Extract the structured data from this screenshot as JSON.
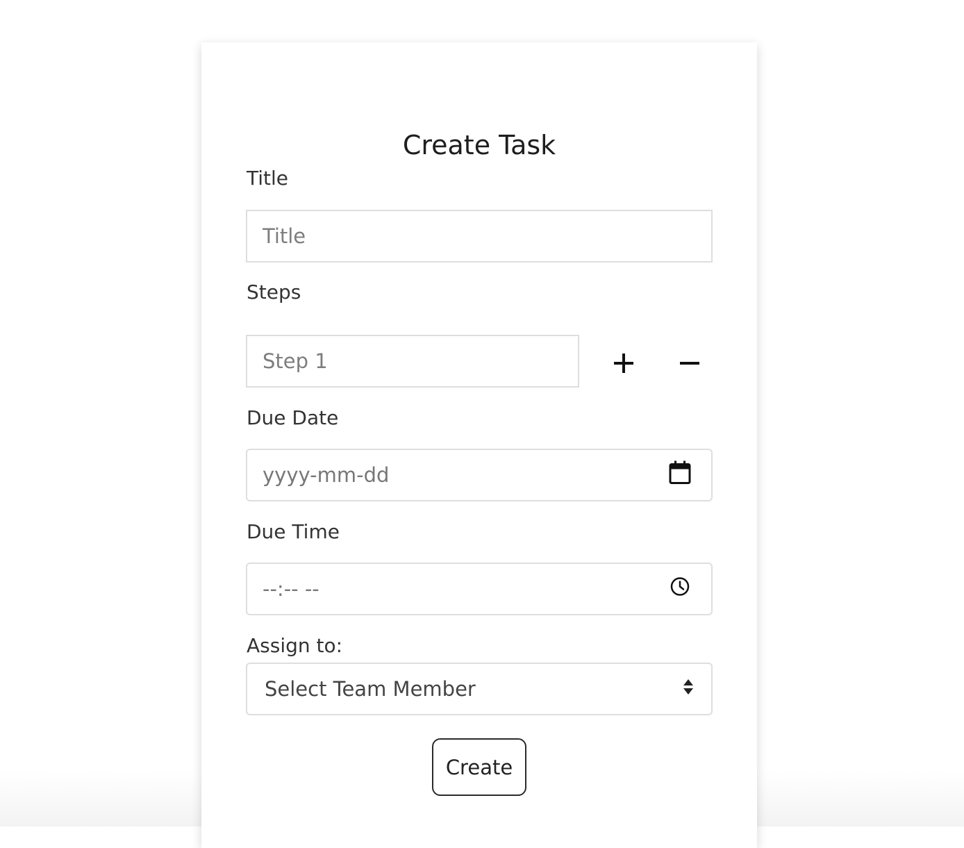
{
  "form": {
    "heading": "Create Task",
    "title_label": "Title",
    "title_placeholder": "Title",
    "steps_label": "Steps",
    "step_placeholder": "Step 1",
    "due_date_label": "Due Date",
    "due_date_placeholder": "yyyy-mm-dd",
    "due_time_label": "Due Time",
    "due_time_placeholder": "--:-- --",
    "assign_label": "Assign to:",
    "assign_selected": "Select Team Member",
    "create_label": "Create"
  },
  "icons": {
    "add_step": "plus-icon",
    "remove_step": "minus-icon",
    "date_picker": "calendar-icon",
    "time_picker": "clock-icon",
    "select_arrows": "sort-arrows-icon"
  },
  "colors": {
    "card_background": "#ffffff",
    "field_border": "#dedede",
    "text": "#222222",
    "placeholder": "#7d7d7d"
  }
}
